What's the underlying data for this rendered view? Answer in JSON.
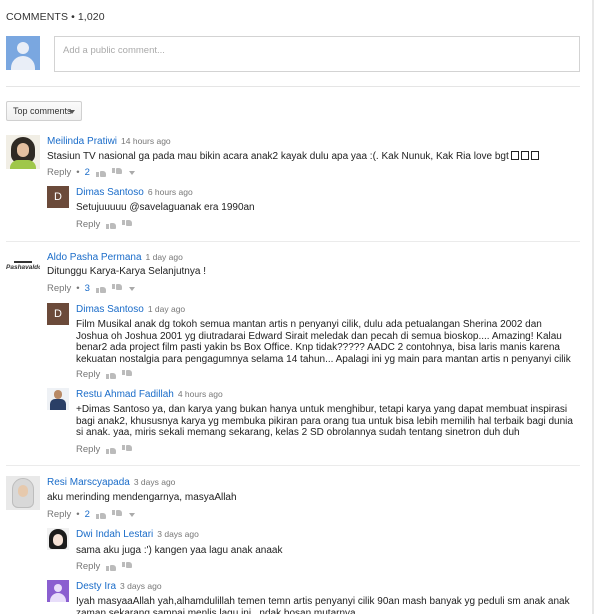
{
  "header": {
    "comments_label": "COMMENTS • 1,020"
  },
  "composer": {
    "placeholder": "Add a public comment..."
  },
  "sort": {
    "label": "Top comments"
  },
  "actions": {
    "reply": "Reply",
    "dot": "•"
  },
  "comments": [
    {
      "author": "Meilinda Pratiwi",
      "time": "14 hours ago",
      "text": "Stasiun TV nasional ga pada mau bikin acara anak2 kayak dulu apa yaa :(. Kak Nunuk, Kak Ria love bgt",
      "reply_count": "2"
    },
    {
      "author": "Dimas Santoso",
      "time": "6 hours ago",
      "avatar_letter": "D",
      "text": "Setujuuuuu @savelaguanak era 1990an"
    },
    {
      "author": "Aldo Pasha Permana",
      "time": "1 day ago",
      "avatar_text": "Pashavaldo",
      "text": "Ditunggu Karya-Karya Selanjutnya !",
      "reply_count": "3"
    },
    {
      "author": "Dimas Santoso",
      "time": "1 day ago",
      "avatar_letter": "D",
      "text": "Film Musikal anak dg tokoh semua mantan artis n penyanyi cilik, dulu ada petualangan Sherina 2002 dan Joshua oh Joshua 2001 yg diutradarai Edward Sirait meledak dan pecah di semua bioskop.... Amazing! Kalau benar2 ada project film pasti yakin bs Box Office. Knp tidak????? AADC 2 contohnya, bisa laris manis karena kekuatan nostalgia para pengagumnya selama 14 tahun... Apalagi ini yg main para mantan artis n penyanyi cilik yg sudah melegenda sejak dulu"
    },
    {
      "author": "Restu Ahmad Fadillah",
      "time": "4 hours ago",
      "text": "+Dimas Santoso ya, dan karya yang bukan hanya untuk menghibur, tetapi karya yang dapat membuat inspirasi bagi anak2, khususnya karya yg membuka pikiran para orang tua untuk bisa lebih memilih hal terbaik bagi dunia si anak. yaa, miris sekali memang sekarang, kelas 2 SD obrolannya sudah tentang sinetron duh duh"
    },
    {
      "author": "Resi Marscyapada",
      "time": "3 days ago",
      "text": "aku merinding mendengarnya, masyaAllah",
      "reply_count": "2"
    },
    {
      "author": "Dwi Indah Lestari",
      "time": "3 days ago",
      "text": "sama aku juga :') kangen yaa lagu anak anaak"
    },
    {
      "author": "Desty Ira",
      "time": "3 days ago",
      "text": "Iyah masyaaAllah yah,alhamdulillah temen temn artis penyanyi cilik 90an mash banyak yg peduli sm anak anak zaman sekarang sampai menlis lagu ini.. ndak bosan mutarnya"
    }
  ]
}
